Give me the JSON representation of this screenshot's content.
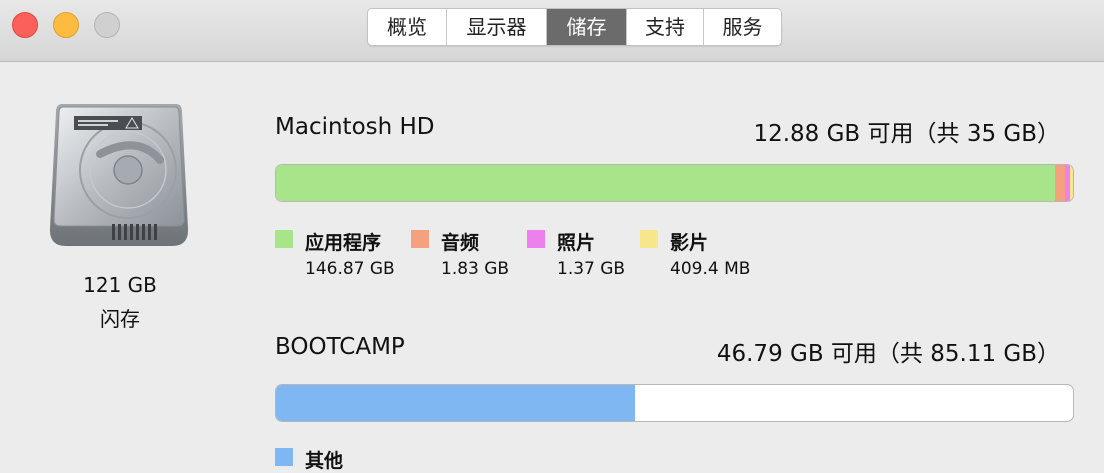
{
  "tabs": [
    {
      "label": "概览",
      "active": false
    },
    {
      "label": "显示器",
      "active": false
    },
    {
      "label": "储存",
      "active": true
    },
    {
      "label": "支持",
      "active": false
    },
    {
      "label": "服务",
      "active": false
    }
  ],
  "device": {
    "size": "121 GB",
    "type": "闪存"
  },
  "volumes": [
    {
      "name": "Macintosh HD",
      "available": "12.88 GB 可用（共 35 GB）",
      "segments": [
        {
          "label": "应用程序",
          "value": "146.87 GB",
          "color": "#a8e58a",
          "fraction": 0.9775
        },
        {
          "label": "音频",
          "value": "1.83 GB",
          "color": "#f5a07f",
          "fraction": 0.0125
        },
        {
          "label": "照片",
          "value": "1.37 GB",
          "color": "#ee80ee",
          "fraction": 0.0063
        },
        {
          "label": "影片",
          "value": "409.4 MB",
          "color": "#f7e68a",
          "fraction": 0.0037
        }
      ]
    },
    {
      "name": "BOOTCAMP",
      "available": "46.79 GB 可用（共 85.11 GB）",
      "segments": [
        {
          "label": "其他",
          "color": "#7fb7f3",
          "fraction": 0.45
        }
      ]
    }
  ]
}
